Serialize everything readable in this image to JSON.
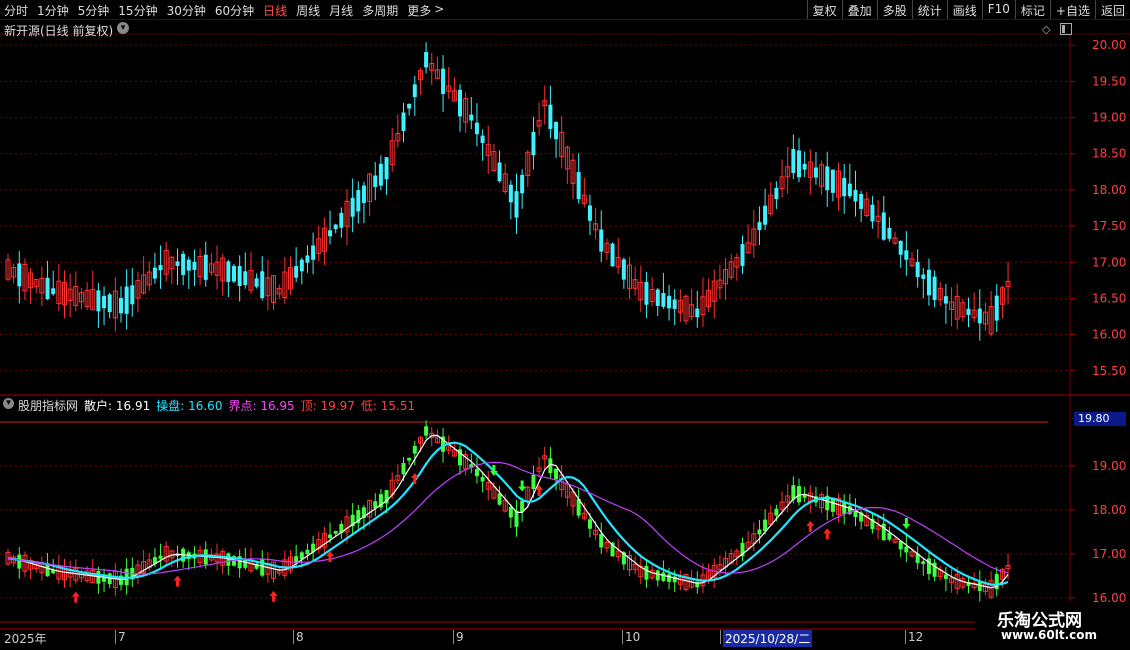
{
  "toolbar": {
    "periods": [
      "分时",
      "1分钟",
      "5分钟",
      "15分钟",
      "30分钟",
      "60分钟",
      "日线",
      "周线",
      "月线",
      "多周期",
      "更多"
    ],
    "active_period": "日线",
    "more_arrow": ">",
    "right_buttons": [
      "复权",
      "叠加",
      "多股",
      "统计",
      "画线",
      "F10",
      "标记",
      "+自选",
      "返回"
    ]
  },
  "main_panel": {
    "title": "新开源(日线 前复权)",
    "title_icon": "chevron-down-icon",
    "diamond_icon": "diamond-icon",
    "panel_icon": "panel-toggle-icon"
  },
  "indicator_panel": {
    "name": "股朋指标网",
    "values": [
      {
        "label": "散户:",
        "value": "16.91",
        "color": "#ffffff"
      },
      {
        "label": "操盘:",
        "value": "16.60",
        "color": "#22e6ff"
      },
      {
        "label": "界点:",
        "value": "16.95",
        "color": "#ff44ff"
      },
      {
        "label": "顶:",
        "value": "19.97",
        "color": "#ff4040"
      },
      {
        "label": "低:",
        "value": "15.51",
        "color": "#ff4040"
      }
    ],
    "ref_line_label": "19.80"
  },
  "date_axis": {
    "labels": [
      "2025年",
      "7",
      "8",
      "9",
      "10",
      "2025/10/28/二",
      "12"
    ],
    "highlighted": "2025/10/28/二"
  },
  "watermark": {
    "line1": "乐淘公式网",
    "line2": "www.60lt.com"
  },
  "chart_data": [
    {
      "type": "candlestick",
      "ylim": [
        15.4,
        20.1
      ],
      "yticks": [
        "15.50",
        "16.00",
        "16.50",
        "17.00",
        "17.50",
        "18.00",
        "18.50",
        "19.00",
        "19.50",
        "20.00"
      ],
      "up_color": "#ff3030",
      "down_color": "#3ff0ff",
      "keypoints": [
        [
          0,
          16.9
        ],
        [
          8,
          16.6
        ],
        [
          20,
          16.4
        ],
        [
          28,
          17.0
        ],
        [
          38,
          16.9
        ],
        [
          48,
          16.6
        ],
        [
          57,
          17.4
        ],
        [
          67,
          18.3
        ],
        [
          74,
          19.8
        ],
        [
          82,
          19.0
        ],
        [
          90,
          17.8
        ],
        [
          95,
          19.2
        ],
        [
          105,
          17.3
        ],
        [
          112,
          16.6
        ],
        [
          122,
          16.3
        ],
        [
          131,
          17.2
        ],
        [
          139,
          18.4
        ],
        [
          149,
          18.0
        ],
        [
          154,
          17.6
        ],
        [
          162,
          16.8
        ],
        [
          167,
          16.4
        ],
        [
          174,
          16.2
        ],
        [
          177,
          16.7
        ]
      ],
      "count": 178
    },
    {
      "type": "line",
      "ylim": [
        15.95,
        20.05
      ],
      "yticks": [
        "16.00",
        "17.00",
        "18.00",
        "19.00"
      ],
      "series": [
        {
          "name": "散户",
          "color": "#ffffff"
        },
        {
          "name": "操盘",
          "color": "#22e6ff"
        },
        {
          "name": "界点",
          "color": "#c040ff"
        }
      ],
      "up_arrows_at": [
        12,
        30,
        47,
        57,
        72,
        94,
        142,
        145
      ],
      "down_arrows_at": [
        86,
        91,
        159
      ]
    }
  ]
}
